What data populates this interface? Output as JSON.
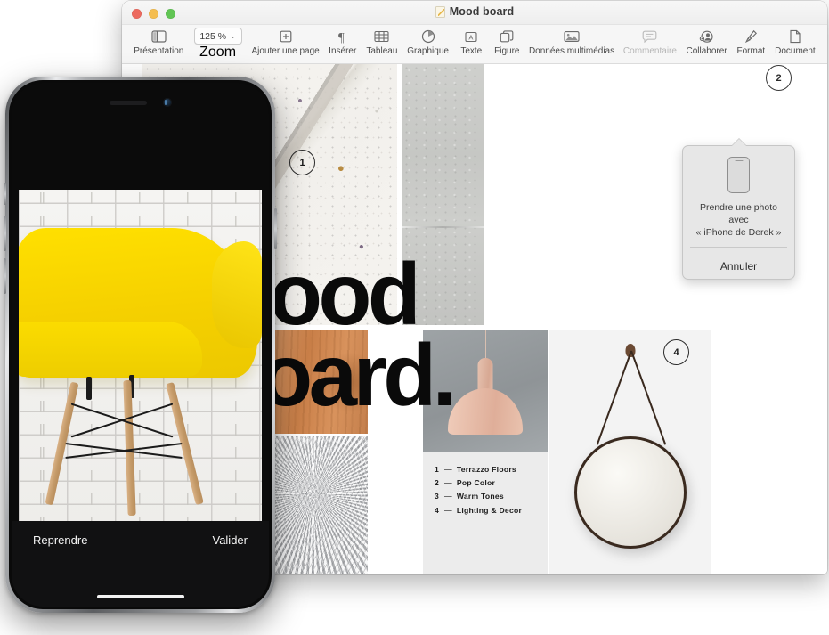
{
  "window": {
    "title": "Mood board",
    "traffic_lights": [
      "close-red",
      "minimize-yellow",
      "zoom-green"
    ],
    "doc_icon": "pages-document-icon"
  },
  "toolbar": {
    "items": [
      {
        "label": "Présentation",
        "icon": "sidebar-view-icon",
        "dim": false
      },
      {
        "label": "Zoom",
        "icon": "zoom-dropdown",
        "dim": false,
        "value": "125 %",
        "chevron": "⌄"
      },
      {
        "label": "Ajouter une page",
        "icon": "add-page-icon",
        "dim": false
      },
      {
        "label": "Insérer",
        "icon": "pilcrow-icon",
        "dim": false
      },
      {
        "label": "Tableau",
        "icon": "table-icon",
        "dim": false
      },
      {
        "label": "Graphique",
        "icon": "chart-pie-icon",
        "dim": false
      },
      {
        "label": "Texte",
        "icon": "text-box-icon",
        "dim": false
      },
      {
        "label": "Figure",
        "icon": "shape-icon",
        "dim": false
      },
      {
        "label": "Données multimédias",
        "icon": "media-image-icon",
        "dim": false
      },
      {
        "label": "Commentaire",
        "icon": "comment-icon",
        "dim": true
      },
      {
        "label": "Collaborer",
        "icon": "collaborate-person-icon",
        "dim": false
      },
      {
        "label": "Format",
        "icon": "format-brush-icon",
        "dim": false
      },
      {
        "label": "Document",
        "icon": "document-icon",
        "dim": false
      }
    ]
  },
  "slide": {
    "headline_line1": "Mood",
    "headline_line2": "Board.",
    "legend": [
      {
        "num": "1",
        "dash": "—",
        "label": "Terrazzo Floors"
      },
      {
        "num": "2",
        "dash": "—",
        "label": "Pop Color"
      },
      {
        "num": "3",
        "dash": "—",
        "label": "Warm Tones"
      },
      {
        "num": "4",
        "dash": "—",
        "label": "Lighting & Decor"
      }
    ],
    "callouts": [
      {
        "id": "1",
        "number": "1"
      },
      {
        "id": "2",
        "number": "2"
      },
      {
        "id": "4",
        "number": "4"
      }
    ],
    "images": [
      {
        "name": "terrazzo-texture-photo"
      },
      {
        "name": "concrete-wall-photo"
      },
      {
        "name": "light-concrete-photo"
      },
      {
        "name": "wood-grain-photo"
      },
      {
        "name": "tan-leather-sofa-photo"
      },
      {
        "name": "grey-fur-rug-photo"
      },
      {
        "name": "pink-pendant-lamp-photo"
      },
      {
        "name": "round-strap-mirror-photo"
      }
    ]
  },
  "popover": {
    "phone_icon": "iphone-icon",
    "message_line1": "Prendre une photo avec",
    "message_line2": "« iPhone de Derek »",
    "cancel_label": "Annuler"
  },
  "iphone": {
    "device": "iphone-continuity-camera",
    "photo": "yellow-eames-chair-photo",
    "retake_label": "Reprendre",
    "confirm_label": "Valider"
  },
  "colors": {
    "window_chrome": "#f6f6f6",
    "popover_bg": "#e7e7e7",
    "headline": "#0a0a0a",
    "chair_yellow": "#ffe000",
    "phone_bar": "#111112"
  }
}
